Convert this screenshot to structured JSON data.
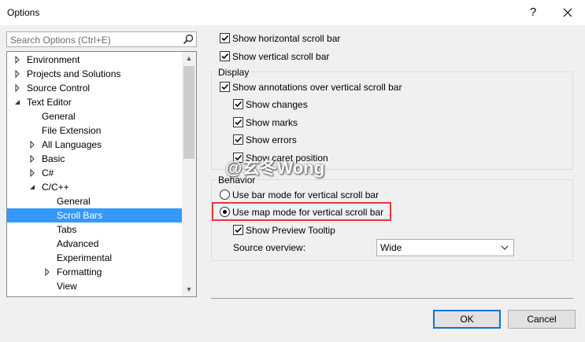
{
  "window": {
    "title": "Options",
    "help_glyph": "?"
  },
  "search": {
    "placeholder": "Search Options (Ctrl+E)"
  },
  "tree": {
    "items": [
      {
        "label": "Environment",
        "arrow": "right"
      },
      {
        "label": "Projects and Solutions",
        "arrow": "right"
      },
      {
        "label": "Source Control",
        "arrow": "right"
      },
      {
        "label": "Text Editor",
        "arrow": "down"
      },
      {
        "label": "General",
        "arrow": "none"
      },
      {
        "label": "File Extension",
        "arrow": "none"
      },
      {
        "label": "All Languages",
        "arrow": "right"
      },
      {
        "label": "Basic",
        "arrow": "right"
      },
      {
        "label": "C#",
        "arrow": "right"
      },
      {
        "label": "C/C++",
        "arrow": "down"
      },
      {
        "label": "General",
        "arrow": "none"
      },
      {
        "label": "Scroll Bars",
        "arrow": "none",
        "selected": true
      },
      {
        "label": "Tabs",
        "arrow": "none"
      },
      {
        "label": "Advanced",
        "arrow": "none"
      },
      {
        "label": "Experimental",
        "arrow": "none"
      },
      {
        "label": "Formatting",
        "arrow": "right"
      },
      {
        "label": "View",
        "arrow": "none"
      }
    ]
  },
  "options": {
    "show_horizontal": "Show horizontal scroll bar",
    "show_vertical": "Show vertical scroll bar",
    "display_group": "Display",
    "show_annotations": "Show annotations over vertical scroll bar",
    "show_changes": "Show changes",
    "show_marks": "Show marks",
    "show_errors": "Show errors",
    "show_caret": "Show caret position",
    "behavior_group": "Behavior",
    "bar_mode": "Use bar mode for vertical scroll bar",
    "map_mode": "Use map mode for vertical scroll bar",
    "preview_tooltip": "Show Preview Tooltip",
    "source_overview_label": "Source overview:",
    "source_overview_value": "Wide"
  },
  "buttons": {
    "ok": "OK",
    "cancel": "Cancel"
  },
  "watermark": "@玄冬Wong",
  "colors": {
    "selection": "#3399ff",
    "highlight_box": "#e8363b",
    "default_button_border": "#0078d7"
  }
}
